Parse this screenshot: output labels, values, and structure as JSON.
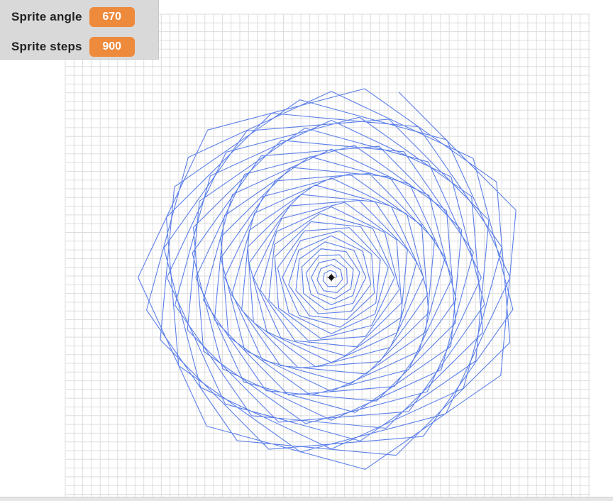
{
  "watchers": [
    {
      "label": "Sprite angle",
      "value": "670"
    },
    {
      "label": "Sprite steps",
      "value": "900"
    }
  ],
  "colors": {
    "watcher_value_bg": "#ee8a3c",
    "pen_stroke": "#5b7fea",
    "grid_line": "#dddddd",
    "sprite_marker": "#111111"
  },
  "icons": {
    "sprite": "star-sprite-icon"
  }
}
